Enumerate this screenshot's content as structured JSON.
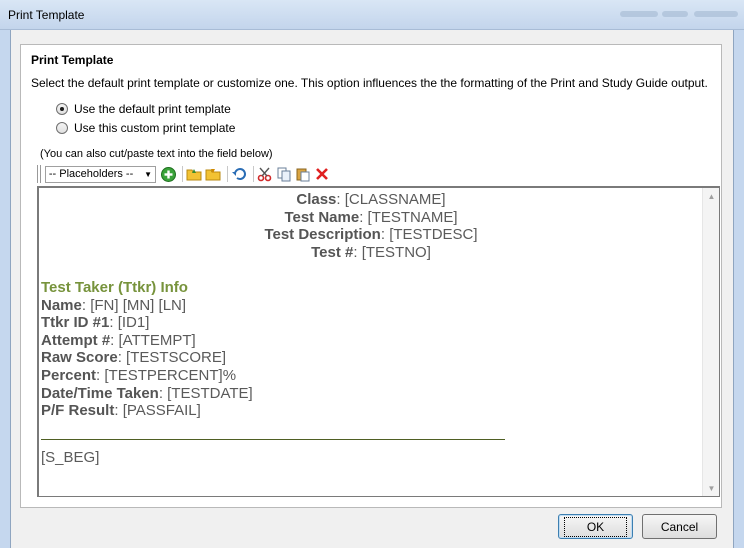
{
  "window": {
    "title": "Print Template"
  },
  "section": {
    "heading": "Print Template",
    "description": "Select the default print template or customize one.  This option influences the the formatting of the Print and Study Guide output."
  },
  "options": {
    "default_label": "Use the default print template",
    "custom_label": "Use this custom print template",
    "selected": "default"
  },
  "hint": "(You can also cut/paste text into the field below)",
  "toolbar": {
    "placeholders_label": "-- Placeholders --",
    "buttons": [
      "add-icon",
      "open-folder-icon",
      "open-folder-alt-icon",
      "undo-icon",
      "cut-icon",
      "copy-icon",
      "paste-icon",
      "delete-icon"
    ]
  },
  "editor": {
    "class_label": "Class",
    "class_value": ": [CLASSNAME]",
    "test_name_label": "Test Name",
    "test_name_value": ": [TESTNAME]",
    "test_desc_label": "Test Description",
    "test_desc_value": ": [TESTDESC]",
    "test_no_label": "Test #",
    "test_no_value": ": [TESTNO]",
    "taker_heading": "Test Taker (Ttkr) Info",
    "name_label": "Name",
    "name_value": ": [FN] [MN] [LN]",
    "ttkr_id_label": "Ttkr ID #1",
    "ttkr_id_value": ": [ID1]",
    "attempt_label": "Attempt #",
    "attempt_value": ": [ATTEMPT]",
    "raw_score_label": "Raw Score",
    "raw_score_value": ": [TESTSCORE]",
    "percent_label": "Percent",
    "percent_value": ": [TESTPERCENT]%",
    "date_label": "Date/Time Taken",
    "date_value": ": [TESTDATE]",
    "pf_label": "P/F Result",
    "pf_value": ": [PASSFAIL]",
    "s_beg": "[S_BEG]"
  },
  "buttons": {
    "ok": "OK",
    "cancel": "Cancel"
  },
  "colors": {
    "accent_green": "#77933c",
    "text_gray": "#5a5a5a"
  }
}
